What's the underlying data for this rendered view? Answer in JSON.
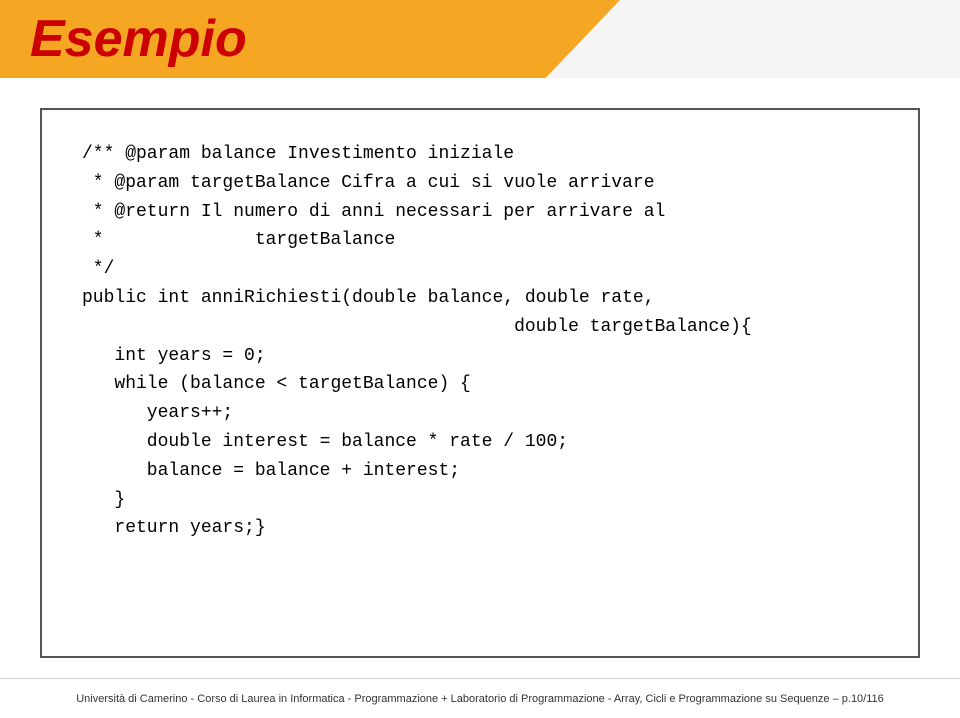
{
  "header": {
    "title": "Esempio",
    "background_color": "#f5a623"
  },
  "code": {
    "lines": [
      "/** @param balance Investimento iniziale",
      " * @param targetBalance Cifra a cui si vuole arrivare",
      " * @return Il numero di anni necessari per arrivare al",
      " *              targetBalance",
      " */",
      "public int anniRichiesti(double balance, double rate,",
      "                                        double targetBalance){",
      "   int years = 0;",
      "   while (balance < targetBalance) {",
      "      years++;",
      "      double interest = balance * rate / 100;",
      "      balance = balance + interest;",
      "   }",
      "   return years;}"
    ]
  },
  "footer": {
    "text": "Università di Camerino - Corso di Laurea in Informatica - Programmazione + Laboratorio di Programmazione - Array, Cicli e Programmazione su Sequenze – p.10/116"
  }
}
